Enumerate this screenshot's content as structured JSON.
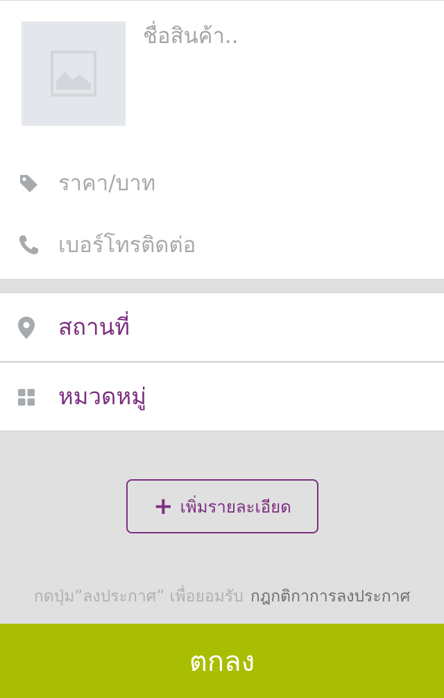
{
  "form": {
    "title_placeholder": "ชื่อสินค้า..",
    "price_placeholder": "ราคา/บาท",
    "phone_placeholder": "เบอร์โทรติดต่อ",
    "photo_icon": "image-placeholder-icon",
    "price_icon": "tag-icon",
    "phone_icon": "phone-icon"
  },
  "selectors": {
    "location_label": "สถานที่",
    "location_icon": "map-pin-icon",
    "category_label": "หมวดหมู่",
    "category_icon": "grid-icon"
  },
  "add_details": {
    "icon": "+",
    "label": "เพิ่มรายละเอียด"
  },
  "terms": {
    "prefix": "กดปุ่ม”ลงประกาศ” เพื่อยอมรับ",
    "link": "กฎกติกาการลงประกาศ"
  },
  "submit_label": "ตกลง",
  "colors": {
    "accent": "#7b2f80",
    "submit": "#a9bd03",
    "background": "#e0e0e0",
    "icon_gray": "#a7abad"
  }
}
